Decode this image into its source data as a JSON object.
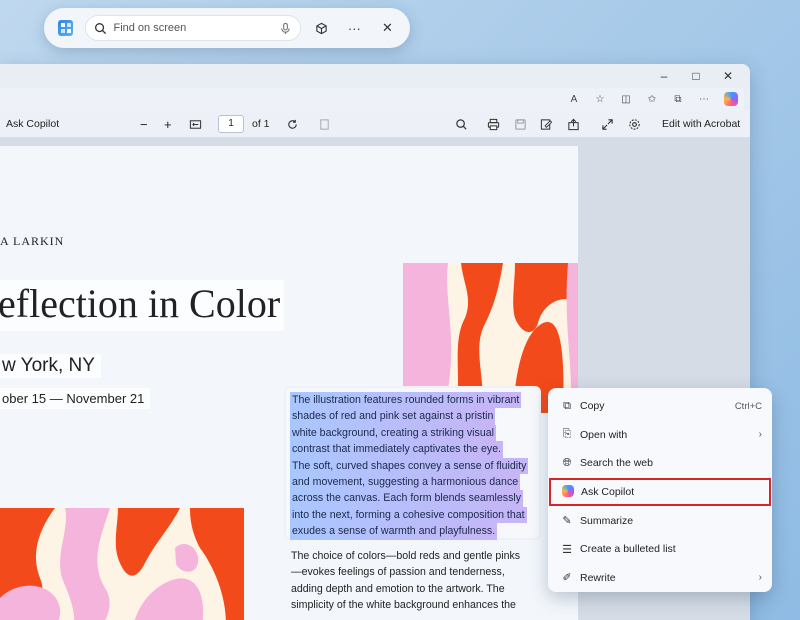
{
  "search_bar": {
    "placeholder": "Find on screen",
    "mic_icon": "mic-icon",
    "lens_icon": "cube-icon",
    "more_label": "···",
    "close_label": "✕"
  },
  "window": {
    "minimize": "–",
    "maximize": "□",
    "close": "✕"
  },
  "address_icons": [
    "A",
    "☆",
    "◫",
    "✩",
    "⧉",
    "⋯"
  ],
  "pdf_toolbar": {
    "ask_copilot": "Ask Copilot",
    "zoom_out": "−",
    "zoom_in": "+",
    "page_number": "1",
    "page_total": "of 1",
    "edit_acrobat": "Edit with Acrobat"
  },
  "document": {
    "author": "A LARKIN",
    "title": "eflection in Color",
    "location": "w York, NY",
    "dates": "ober 15 — November 21",
    "highlighted_lines": [
      "The illustration features rounded forms in vibrant",
      "shades of red and pink set against a pristin",
      "white background, creating a striking visual",
      "contrast that immediately captivates the eye.",
      "The soft, curved shapes convey a sense of fluidity",
      "and movement, suggesting a harmonious dance",
      "across the canvas. Each form blends seamlessly",
      "into the next, forming a cohesive composition that",
      "exudes a sense of warmth and playfulness."
    ],
    "body_lines": [
      "The choice of colors—bold reds and gentle pinks",
      "—evokes feelings of passion and tenderness,",
      "adding depth and emotion to the artwork. The",
      "simplicity of the white background enhances the"
    ]
  },
  "context_menu": {
    "items": [
      {
        "label": "Copy",
        "shortcut": "Ctrl+C",
        "icon": "copy-icon"
      },
      {
        "label": "Open with",
        "shortcut": "›",
        "icon": "open-with-icon"
      },
      {
        "label": "Search the web",
        "shortcut": "",
        "icon": "globe-icon"
      },
      {
        "label": "Ask Copilot",
        "shortcut": "",
        "icon": "copilot-icon"
      },
      {
        "label": "Summarize",
        "shortcut": "",
        "icon": "summarize-icon"
      },
      {
        "label": "Create a bulleted list",
        "shortcut": "",
        "icon": "list-icon"
      },
      {
        "label": "Rewrite",
        "shortcut": "›",
        "icon": "rewrite-icon"
      }
    ],
    "highlight_color": "#d62626"
  },
  "colors": {
    "art_red": "#f24a1a",
    "art_pink": "#f5b4dc",
    "art_cream": "#fdf4e6",
    "selection_blue": "#a9c7ff",
    "selection_purple": "#c7b5f7"
  }
}
